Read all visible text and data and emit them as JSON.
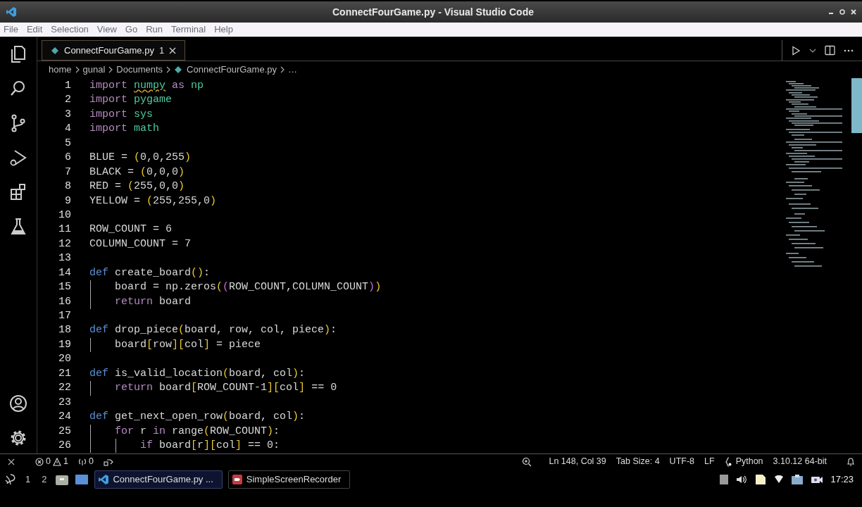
{
  "window": {
    "title": "ConnectFourGame.py - Visual Studio Code"
  },
  "menu": [
    "File",
    "Edit",
    "Selection",
    "View",
    "Go",
    "Run",
    "Terminal",
    "Help"
  ],
  "activity_bar": [
    {
      "kind": "files",
      "selected": false
    },
    {
      "kind": "search",
      "selected": false
    },
    {
      "kind": "source-control",
      "selected": false
    },
    {
      "kind": "run-debug",
      "selected": false
    },
    {
      "kind": "extensions",
      "selected": false
    },
    {
      "kind": "testing",
      "selected": false
    },
    {
      "kind": "accounts",
      "selected": false
    },
    {
      "kind": "settings",
      "selected": false
    }
  ],
  "tabs": [
    {
      "label": "ConnectFourGame.py",
      "problems": "1",
      "selected": true
    }
  ],
  "breadcrumbs": [
    "home",
    "gunal",
    "Documents",
    "ConnectFourGame.py",
    "…"
  ],
  "editor": {
    "lines": [
      {
        "number": "1",
        "segments": [
          {
            "text": "import ",
            "kind": "keyword"
          },
          {
            "text": "numpy",
            "kind": "module",
            "warning": true
          },
          {
            "text": " as ",
            "kind": "keyword"
          },
          {
            "text": "np",
            "kind": "module"
          }
        ]
      },
      {
        "number": "2",
        "segments": [
          {
            "text": "import ",
            "kind": "keyword"
          },
          {
            "text": "pygame",
            "kind": "module"
          }
        ]
      },
      {
        "number": "3",
        "segments": [
          {
            "text": "import ",
            "kind": "keyword"
          },
          {
            "text": "sys",
            "kind": "module"
          }
        ]
      },
      {
        "number": "4",
        "segments": [
          {
            "text": "import ",
            "kind": "keyword"
          },
          {
            "text": "math",
            "kind": "module"
          }
        ]
      },
      {
        "number": "5"
      },
      {
        "number": "6",
        "segments": [
          {
            "text": "BLUE = ",
            "kind": "plain"
          },
          {
            "text": "(",
            "kind": "bracket"
          },
          {
            "text": "0,0,255",
            "kind": "plain"
          },
          {
            "text": ")",
            "kind": "bracket"
          }
        ]
      },
      {
        "number": "7",
        "segments": [
          {
            "text": "BLACK = ",
            "kind": "plain"
          },
          {
            "text": "(",
            "kind": "bracket"
          },
          {
            "text": "0,0,0",
            "kind": "plain"
          },
          {
            "text": ")",
            "kind": "bracket"
          }
        ]
      },
      {
        "number": "8",
        "segments": [
          {
            "text": "RED = ",
            "kind": "plain"
          },
          {
            "text": "(",
            "kind": "bracket"
          },
          {
            "text": "255,0,0",
            "kind": "plain"
          },
          {
            "text": ")",
            "kind": "bracket"
          }
        ]
      },
      {
        "number": "9",
        "segments": [
          {
            "text": "YELLOW = ",
            "kind": "plain"
          },
          {
            "text": "(",
            "kind": "bracket"
          },
          {
            "text": "255,255,0",
            "kind": "plain"
          },
          {
            "text": ")",
            "kind": "bracket"
          }
        ]
      },
      {
        "number": "10"
      },
      {
        "number": "11",
        "segments": [
          {
            "text": "ROW_COUNT = 6",
            "kind": "plain"
          }
        ]
      },
      {
        "number": "12",
        "segments": [
          {
            "text": "COLUMN_COUNT = 7",
            "kind": "plain"
          }
        ]
      },
      {
        "number": "13"
      },
      {
        "number": "14",
        "segments": [
          {
            "text": "def ",
            "kind": "definition"
          },
          {
            "text": "create_board",
            "kind": "plain"
          },
          {
            "text": "()",
            "kind": "bracket"
          },
          {
            "text": ":",
            "kind": "plain"
          }
        ]
      },
      {
        "number": "15",
        "segments": [
          {
            "text": "    board = np.zeros",
            "kind": "plain"
          },
          {
            "text": "(",
            "kind": "bracket"
          },
          {
            "text": "(",
            "kind": "bracket2"
          },
          {
            "text": "ROW_COUNT,COLUMN_COUNT",
            "kind": "plain"
          },
          {
            "text": ")",
            "kind": "bracket2"
          },
          {
            "text": ")",
            "kind": "bracket"
          }
        ]
      },
      {
        "number": "16",
        "segments": [
          {
            "text": "    return ",
            "kind": "keyword"
          },
          {
            "text": "board",
            "kind": "plain"
          }
        ]
      },
      {
        "number": "17"
      },
      {
        "number": "18",
        "segments": [
          {
            "text": "def ",
            "kind": "definition"
          },
          {
            "text": "drop_piece",
            "kind": "plain"
          },
          {
            "text": "(",
            "kind": "bracket"
          },
          {
            "text": "board, row, col, piece",
            "kind": "plain"
          },
          {
            "text": ")",
            "kind": "bracket"
          },
          {
            "text": ":",
            "kind": "plain"
          }
        ]
      },
      {
        "number": "19",
        "segments": [
          {
            "text": "    board",
            "kind": "plain"
          },
          {
            "text": "[",
            "kind": "bracket"
          },
          {
            "text": "row",
            "kind": "plain"
          },
          {
            "text": "][",
            "kind": "bracket"
          },
          {
            "text": "col",
            "kind": "plain"
          },
          {
            "text": "]",
            "kind": "bracket"
          },
          {
            "text": " = piece",
            "kind": "plain"
          }
        ]
      },
      {
        "number": "20"
      },
      {
        "number": "21",
        "segments": [
          {
            "text": "def ",
            "kind": "definition"
          },
          {
            "text": "is_valid_location",
            "kind": "plain"
          },
          {
            "text": "(",
            "kind": "bracket"
          },
          {
            "text": "board, col",
            "kind": "plain"
          },
          {
            "text": ")",
            "kind": "bracket"
          },
          {
            "text": ":",
            "kind": "plain"
          }
        ]
      },
      {
        "number": "22",
        "segments": [
          {
            "text": "    return ",
            "kind": "keyword"
          },
          {
            "text": "board",
            "kind": "plain"
          },
          {
            "text": "[",
            "kind": "bracket"
          },
          {
            "text": "ROW_COUNT-1",
            "kind": "plain"
          },
          {
            "text": "][",
            "kind": "bracket"
          },
          {
            "text": "col",
            "kind": "plain"
          },
          {
            "text": "]",
            "kind": "bracket"
          },
          {
            "text": " == 0",
            "kind": "plain"
          }
        ]
      },
      {
        "number": "23"
      },
      {
        "number": "24",
        "segments": [
          {
            "text": "def ",
            "kind": "definition"
          },
          {
            "text": "get_next_open_row",
            "kind": "plain"
          },
          {
            "text": "(",
            "kind": "bracket"
          },
          {
            "text": "board, col",
            "kind": "plain"
          },
          {
            "text": ")",
            "kind": "bracket"
          },
          {
            "text": ":",
            "kind": "plain"
          }
        ]
      },
      {
        "number": "25",
        "segments": [
          {
            "text": "    for ",
            "kind": "keyword"
          },
          {
            "text": "r ",
            "kind": "plain"
          },
          {
            "text": "in ",
            "kind": "keyword"
          },
          {
            "text": "range",
            "kind": "plain"
          },
          {
            "text": "(",
            "kind": "bracket"
          },
          {
            "text": "ROW_COUNT",
            "kind": "plain"
          },
          {
            "text": ")",
            "kind": "bracket"
          },
          {
            "text": ":",
            "kind": "plain"
          }
        ]
      },
      {
        "number": "26",
        "segments": [
          {
            "text": "        if ",
            "kind": "keyword"
          },
          {
            "text": "board",
            "kind": "plain"
          },
          {
            "text": "[",
            "kind": "bracket"
          },
          {
            "text": "r",
            "kind": "plain"
          },
          {
            "text": "][",
            "kind": "bracket"
          },
          {
            "text": "col",
            "kind": "plain"
          },
          {
            "text": "]",
            "kind": "bracket"
          },
          {
            "text": " == 0:",
            "kind": "plain"
          }
        ]
      }
    ]
  },
  "status_bar": {
    "errors": "0",
    "warnings": "1",
    "ports": "0",
    "right": [
      "Ln 148, Col 39",
      "Tab Size: 4",
      "UTF-8",
      "LF"
    ],
    "language": "Python",
    "interpreter": "3.10.12 64-bit"
  },
  "taskbar": {
    "workspaces": [
      {
        "label": "1",
        "selected": false
      },
      {
        "label": "2",
        "selected": false
      }
    ],
    "tasks": [
      {
        "label": "ConnectFourGame.py ...",
        "kind": "vscode",
        "selected": true
      },
      {
        "label": "SimpleScreenRecorder",
        "kind": "recorder",
        "selected": false
      }
    ],
    "clock": "17:23"
  }
}
